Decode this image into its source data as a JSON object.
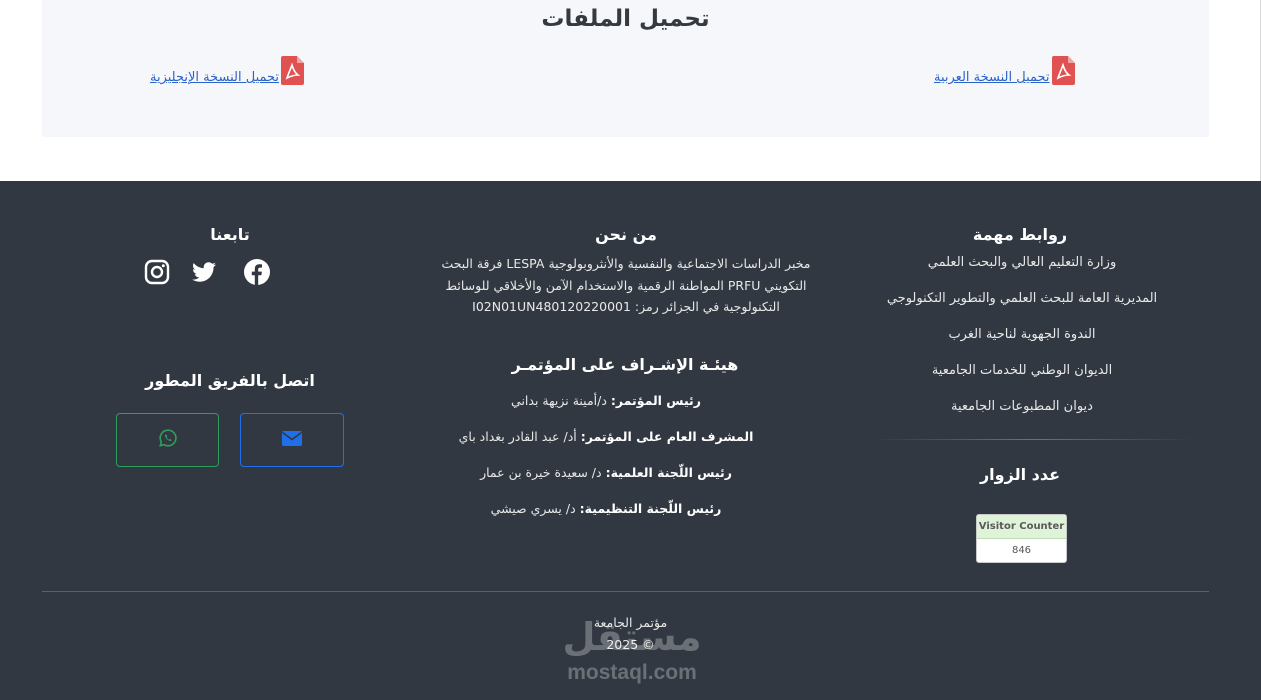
{
  "downloads": {
    "title": "تحميل الملفات",
    "arabic_label": "تحميل النسخة العربية",
    "english_label": "تحميل النسخة الإنجليزية"
  },
  "footer": {
    "links": {
      "title": "روابط مهمة",
      "items": [
        "وزارة التعليم العالي والبحث العلمي",
        "المديرية العامة للبحث العلمي والتطوير التكنولوجي",
        "الندوة الجهوية لناحية الغرب",
        "الديوان الوطني للخدمات الجامعية",
        "ديوان المطبوعات الجامعية"
      ]
    },
    "visitors": {
      "title": "عدد الزوار",
      "counter_label": "Visitor Counter",
      "count": "846"
    },
    "about": {
      "title": "من نحن",
      "text": "مخبر الدراسات الاجتماعية والنفسية والأنثروبولوجية LESPA فرقة البحث التكويني PRFU المواطنة الرقمية والاستخدام الآمن والأخلاقي للوسائط التكنولوجية في الجزائر رمز: I02N01UN480120220001"
    },
    "board": {
      "title": "هيئـة الإشـراف على المؤتمـر",
      "members": [
        {
          "role": "رئيس المؤتمر:",
          "name": "د/أمينة نزيهة بداني"
        },
        {
          "role": "المشرف العام على المؤتمر:",
          "name": "أد/ عبد القادر بغداد باي"
        },
        {
          "role": "رئيس اللّجنة العلمية:",
          "name": "د/ سعيدة خيرة بن عمار"
        },
        {
          "role": "رئيس اللّجنة التنظيمية:",
          "name": "د/ يسري صيشي"
        }
      ]
    },
    "follow": {
      "title": "تابعنا"
    },
    "contact": {
      "title": "اتصل بالفريق المطور"
    },
    "copyright": {
      "line1": "مؤتمر الجامعة",
      "line2": "© 2025"
    },
    "watermark": {
      "arabic": "مستقل",
      "latin": "mostaql.com"
    }
  },
  "colors": {
    "footer_bg": "#323841",
    "link_blue": "#2a63c9",
    "pdf_red": "#e05252",
    "mail_blue": "#1f6feb",
    "whatsapp_green": "#2f9e5a"
  }
}
